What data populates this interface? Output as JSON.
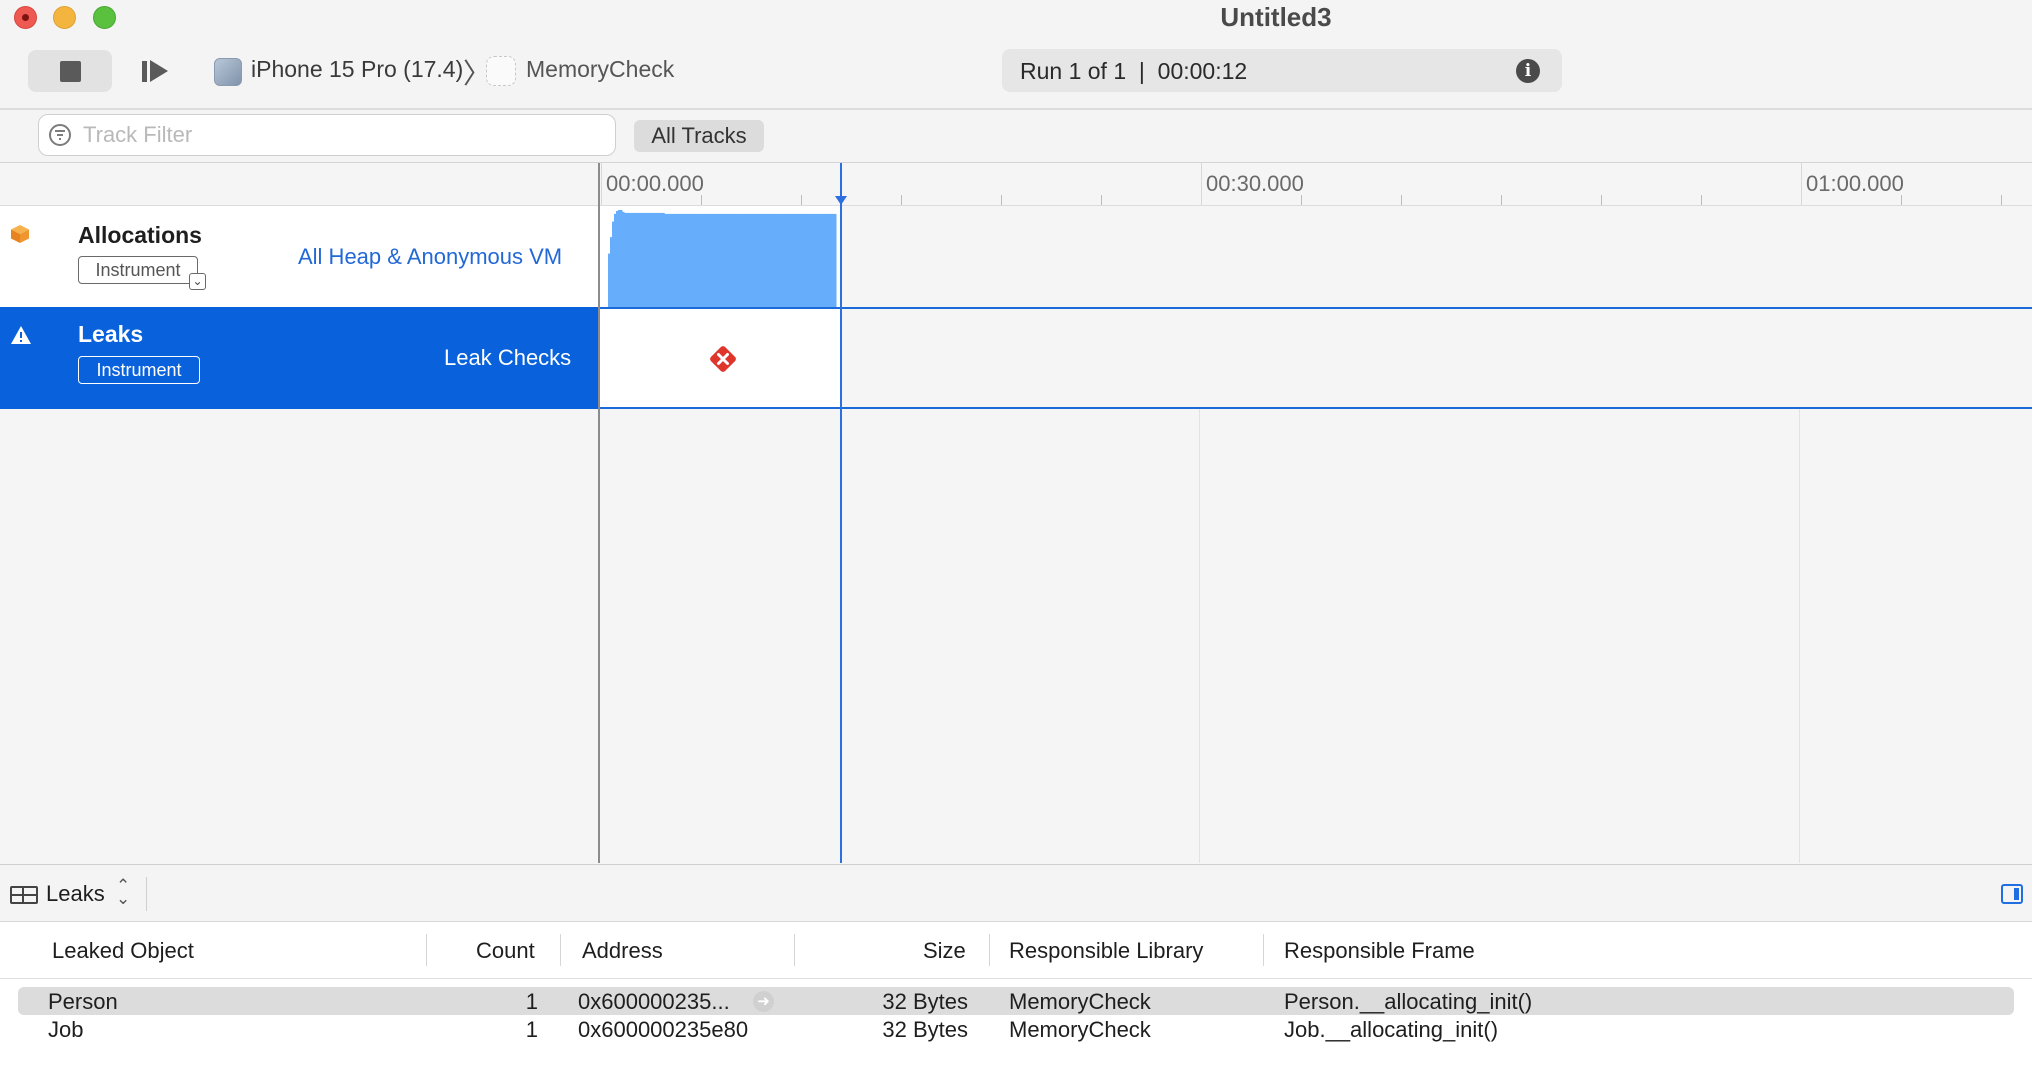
{
  "window": {
    "title": "Untitled3"
  },
  "toolbar": {
    "device": "iPhone 15 Pro (17.4)",
    "separator": "〉",
    "app": "MemoryCheck",
    "run_status": "Run 1 of 1  |  00:00:12",
    "info_glyph": "i"
  },
  "filter": {
    "placeholder": "Track Filter",
    "scope_button": "All Tracks"
  },
  "ruler": {
    "labels": [
      "00:00.000",
      "00:30.000",
      "01:00.000"
    ]
  },
  "tracks": [
    {
      "title": "Allocations",
      "badge": "Instrument",
      "detail": "All Heap & Anonymous VM",
      "icon": "cube-icon",
      "color": "#f0962e"
    },
    {
      "title": "Leaks",
      "badge": "Instrument",
      "detail": "Leak Checks",
      "icon": "warning-icon",
      "selected": true
    }
  ],
  "allocations_chart": {
    "series_color": "#66aefc",
    "levels": [
      0.55,
      0.72,
      0.88,
      0.96,
      0.99,
      1.0,
      1.0,
      0.98,
      0.97,
      0.97,
      0.97,
      0.97,
      0.96,
      0.96,
      0.96,
      0.96,
      0.96,
      0.96,
      0.96,
      0.96,
      0.96,
      0.96,
      0.96,
      0.96,
      0.96,
      0.96,
      0.96,
      0.96,
      0.96
    ]
  },
  "leaks_chart": {
    "marker_color": "#e0352b",
    "marker_count": 1
  },
  "detail": {
    "view": "Leaks",
    "chevron": "⌃⌄"
  },
  "table": {
    "columns": [
      "Leaked Object",
      "Count",
      "Address",
      "Size",
      "Responsible Library",
      "Responsible Frame"
    ],
    "rows": [
      {
        "object": "Person",
        "count": "1",
        "address": "0x600000235...",
        "size": "32 Bytes",
        "library": "MemoryCheck",
        "frame": "Person.__allocating_init()",
        "selected": true
      },
      {
        "object": "Job",
        "count": "1",
        "address": "0x600000235e80",
        "size": "32 Bytes",
        "library": "MemoryCheck",
        "frame": "Job.__allocating_init()",
        "selected": false
      }
    ]
  }
}
